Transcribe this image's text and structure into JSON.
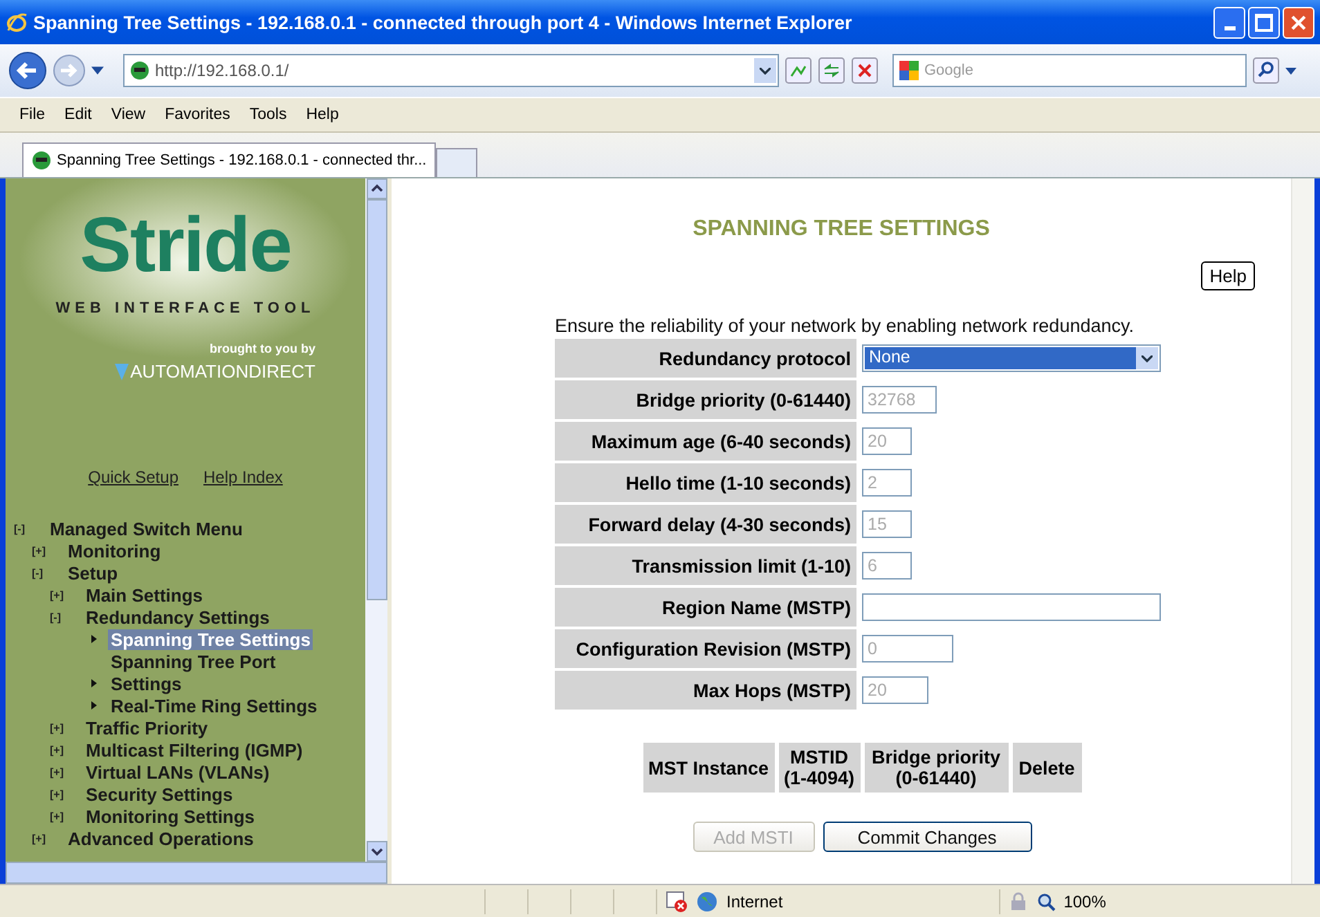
{
  "window": {
    "title": "Spanning Tree Settings - 192.168.0.1 - connected through port 4 - Windows Internet Explorer"
  },
  "address_bar": {
    "url": "http://192.168.0.1/"
  },
  "search": {
    "placeholder": "Google"
  },
  "menu": [
    "File",
    "Edit",
    "View",
    "Favorites",
    "Tools",
    "Help"
  ],
  "tabs": [
    {
      "label": "Spanning Tree Settings - 192.168.0.1 - connected thr...",
      "selected": true
    }
  ],
  "sidebar": {
    "logo": {
      "name": "Stride",
      "tagline": "WEB INTERFACE TOOL",
      "credit": "brought to you by",
      "company": "AUTOMATIONDIRECT"
    },
    "links": [
      "Quick Setup",
      "Help Index"
    ],
    "tree": [
      {
        "label": "Managed Switch Menu",
        "toggle": "[-]",
        "selected": false,
        "children": [
          {
            "label": "Monitoring",
            "toggle": "[+]",
            "selected": false
          },
          {
            "label": "Setup",
            "toggle": "[-]",
            "selected": false,
            "children": [
              {
                "label": "Main Settings",
                "toggle": "[+]",
                "selected": false
              },
              {
                "label": "Redundancy Settings",
                "toggle": "[-]",
                "selected": false,
                "children": [
                  {
                    "label": "Spanning Tree Settings",
                    "bullet": true,
                    "selected": true
                  },
                  {
                    "label": "Spanning Tree Port",
                    "bullet": false,
                    "selected": false
                  },
                  {
                    "label": "Settings",
                    "bullet": true,
                    "selected": false
                  },
                  {
                    "label": "Real-Time Ring Settings",
                    "bullet": true,
                    "selected": false
                  }
                ]
              },
              {
                "label": "Traffic Priority",
                "toggle": "[+]",
                "selected": false
              },
              {
                "label": "Multicast Filtering (IGMP)",
                "toggle": "[+]",
                "selected": false
              },
              {
                "label": "Virtual LANs (VLANs)",
                "toggle": "[+]",
                "selected": false
              },
              {
                "label": "Security Settings",
                "toggle": "[+]",
                "selected": false
              },
              {
                "label": "Monitoring Settings",
                "toggle": "[+]",
                "selected": false
              }
            ]
          },
          {
            "label": "Advanced Operations",
            "toggle": "[+]",
            "selected": false
          }
        ]
      }
    ]
  },
  "page": {
    "heading": "SPANNING TREE SETTINGS",
    "help_button": "Help",
    "intro": "Ensure the reliability of your network by enabling network redundancy.",
    "fields": [
      {
        "label": "Redundancy protocol",
        "kind": "select",
        "value": "None",
        "disabled": false
      },
      {
        "label": "Bridge priority (0-61440)",
        "kind": "medium",
        "value": "32768",
        "disabled": true
      },
      {
        "label": "Maximum age (6-40 seconds)",
        "kind": "short",
        "value": "20",
        "disabled": true
      },
      {
        "label": "Hello time (1-10 seconds)",
        "kind": "short",
        "value": "2",
        "disabled": true
      },
      {
        "label": "Forward delay (4-30 seconds)",
        "kind": "short",
        "value": "15",
        "disabled": true
      },
      {
        "label": "Transmission limit (1-10)",
        "kind": "short",
        "value": "6",
        "disabled": true
      },
      {
        "label": "Region Name (MSTP)",
        "kind": "wide"
      },
      {
        "label": "Configuration Revision (MSTP)",
        "kind": "long",
        "value": "0",
        "disabled": true
      },
      {
        "label": "Max Hops (MSTP)",
        "kind": "medium-short",
        "value": "20",
        "disabled": true
      }
    ],
    "mst_table": {
      "columns": [
        "MST Instance",
        "MSTID (1-4094)",
        "Bridge priority (0-61440)",
        "Delete"
      ]
    },
    "buttons": [
      {
        "label": "Add MSTI",
        "disabled": true
      },
      {
        "label": "Commit Changes",
        "disabled": false
      }
    ]
  },
  "status_bar": {
    "zone": "Internet",
    "zoom": "100%"
  }
}
